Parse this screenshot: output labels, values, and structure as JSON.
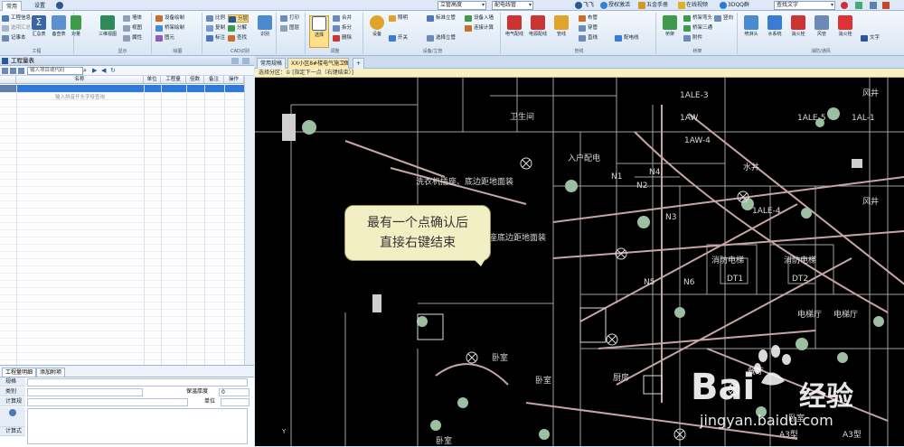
{
  "menubar": {
    "tabs": [
      "常用",
      "设置"
    ],
    "combo1": "立管高度",
    "combo2": "配电线管",
    "links": [
      "飞飞",
      "授权激活",
      "五金手册",
      "在线视频",
      "3DQQ群"
    ],
    "search_placeholder": "查找文字"
  },
  "ribbon": {
    "groups": [
      {
        "label": "工程",
        "buttons": [
          "工程信息",
          "选项汇总",
          "记事本",
          "汇总表",
          "备查表",
          "对量"
        ]
      },
      {
        "label": "显示",
        "buttons": [
          "三维视图",
          "墙体",
          "视图",
          "属性"
        ]
      },
      {
        "label": "绘图",
        "buttons": [
          "设备绘制",
          "桥架绘制",
          "图元",
          "线条",
          "矩形"
        ]
      },
      {
        "label": "CAD识别",
        "buttons": [
          "比例",
          "分层",
          "复制",
          "分解",
          "标注",
          "查找",
          "识别"
        ]
      },
      {
        "label": "",
        "buttons": [
          "打印",
          "图层"
        ]
      },
      {
        "label": "调整",
        "buttons": [
          "选择",
          "合并",
          "拆分",
          "删除",
          "打断"
        ]
      },
      {
        "label": "设备/立管",
        "buttons": [
          "设备",
          "照明",
          "开关",
          "标准立管",
          "选择立管",
          "设备入墙",
          "连接计算"
        ]
      },
      {
        "label": "管线",
        "buttons": [
          "电气配线",
          "电源配线",
          "管线",
          "布管",
          "穿管",
          "直线",
          "配电线"
        ]
      },
      {
        "label": "桥架",
        "buttons": [
          "桥架",
          "桥架弯头",
          "桥架三通",
          "附件",
          "竖向"
        ]
      },
      {
        "label": "消防/通风",
        "buttons": [
          "喷淋头",
          "水系统",
          "消火栓",
          "风管",
          "消火栓",
          "文字"
        ]
      }
    ]
  },
  "left_panel": {
    "title": "工程量表",
    "search_placeholder": "输入项目或代码",
    "columns": [
      "名称",
      "单位",
      "工程量",
      "倍数",
      "备注",
      "",
      "操作"
    ],
    "empty_hint": "输入拼音开头字母查询",
    "bottom_tabs": [
      "工程量明细",
      "添加附项"
    ],
    "props": [
      "规格",
      "类别",
      "计算规则",
      "",
      "计算式"
    ],
    "prop_labels_right": [
      "保温厚度",
      "单位"
    ],
    "prop_value_thick": "0"
  },
  "drawing": {
    "tabs": [
      "常用规格",
      "XX小区8#楼电气施工图",
      "+"
    ],
    "hint": "选择分区：① [指定下一点（右键结束）]",
    "tooltip_line1": "最有一个点确认后",
    "tooltip_line2": "直接右键结束",
    "cad_labels": [
      "洗衣机插座、底边距地面装",
      "入户配电",
      "水井",
      "消防电梯",
      "消防电梯",
      "DT1",
      "DT2",
      "风井",
      "风井",
      "卧室",
      "卧室",
      "餐厅",
      "卧室",
      "厨房",
      "A3型",
      "A3型",
      "1ALE-3",
      "1ALE-4",
      "1AL-1",
      "1AW-4",
      "1ALE-5",
      "1AW",
      "N1",
      "N2",
      "N3",
      "N4",
      "N5",
      "N6",
      "插座底边距地面装",
      "卫生间",
      "卧室",
      "电梯厅",
      "电梯厅"
    ]
  },
  "watermark": {
    "brand": "Bai",
    "brand2": "经验",
    "url": "jingyan.baidu.com"
  },
  "colors": {
    "accent": "#2b5797",
    "canvas": "#000000",
    "tooltip": "#f3efc4",
    "hint": "#f8f0c2"
  }
}
